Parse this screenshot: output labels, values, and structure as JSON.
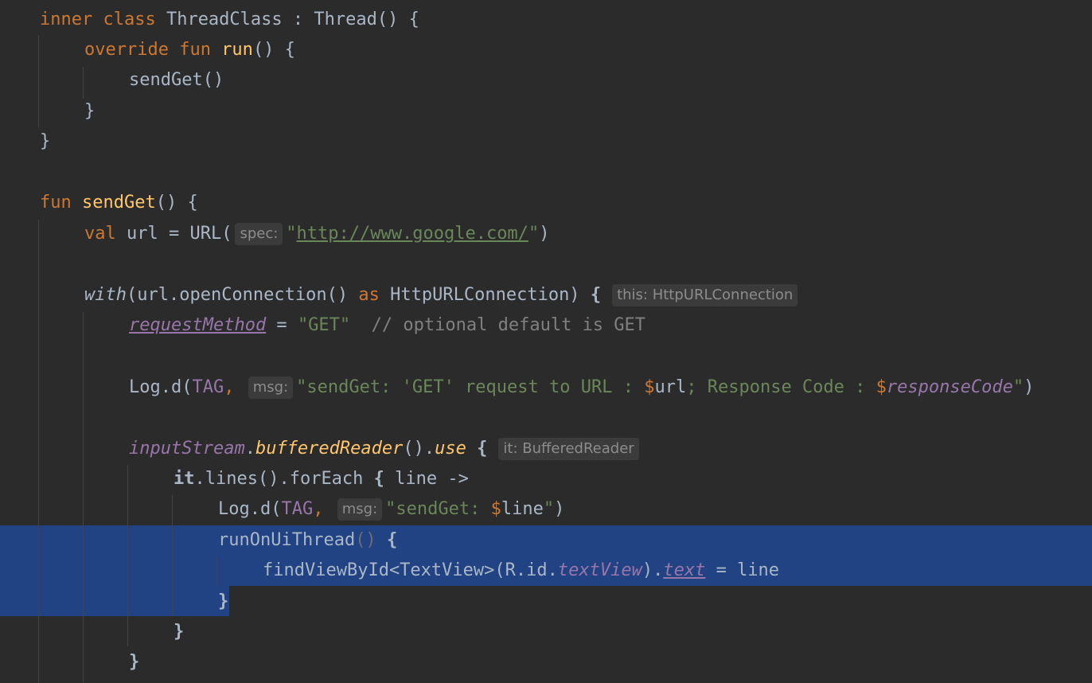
{
  "colors": {
    "background": "#2b2b2b",
    "selection": "#214283",
    "keyword": "#cc7832",
    "function": "#ffc66d",
    "string": "#6a8759",
    "comment": "#808080",
    "property": "#9876aa",
    "default": "#a9b7c6"
  },
  "code": {
    "l1": {
      "kw": "inner class ",
      "rest": "ThreadClass : Thread() {"
    },
    "l2": {
      "kw": "override fun ",
      "fn": "run",
      "rest": "() {"
    },
    "l3": {
      "text": "sendGet()"
    },
    "l4": {
      "text": "}"
    },
    "l5": {
      "text": "}"
    },
    "l6": {
      "kw": "fun ",
      "fn": "sendGet",
      "rest": "() {"
    },
    "l7": {
      "kw": "val ",
      "a": "url = URL(",
      "hint": "spec:",
      "q1": "\"",
      "url": "http://www.google.com/",
      "q2": "\"",
      "end": ")"
    },
    "l8": {
      "with": "with",
      "a": "(url.openConnection() ",
      "kw": "as ",
      "b": "HttpURLConnection) ",
      "brace": "{",
      "hint": "this: HttpURLConnection"
    },
    "l9": {
      "prop": "requestMethod",
      "a": " = ",
      "str": "\"GET\"",
      "cmt": "  // optional default is GET"
    },
    "l10": {
      "a": "Log.d(",
      "tag": "TAG",
      "comma": ", ",
      "hint": "msg:",
      "s1": "\"sendGet: 'GET' request to URL : ",
      "d1": "$",
      "v1": "url",
      "s2": "; Response Code : ",
      "d2": "$",
      "v2": "responseCode",
      "s3": "\"",
      "end": ")"
    },
    "l11": {
      "ext": "inputStream",
      "dot": ".",
      "fn": "bufferedReader",
      "a": "().",
      "use": "use",
      "sp": " ",
      "brace": "{",
      "hint": "it: BufferedReader"
    },
    "l12": {
      "it": "it",
      "a": ".lines().forEach ",
      "brace": "{",
      "b": " line ->"
    },
    "l13": {
      "a": "Log.d(",
      "tag": "TAG",
      "comma": ", ",
      "hint": "msg:",
      "s1": "\"sendGet: ",
      "d1": "$",
      "v1": "line",
      "s2": "\"",
      "end": ")"
    },
    "l14": {
      "a": "runOnUiThread",
      "paren": "()",
      "sp": " ",
      "brace": "{"
    },
    "l15": {
      "a": "findViewById<TextView>(R.id.",
      "ext": "textView",
      "b": ").",
      "prop": "text",
      "c": " = line"
    },
    "l16": {
      "brace": "}"
    },
    "l17": {
      "brace": "}"
    },
    "l18": {
      "brace": "}"
    }
  }
}
